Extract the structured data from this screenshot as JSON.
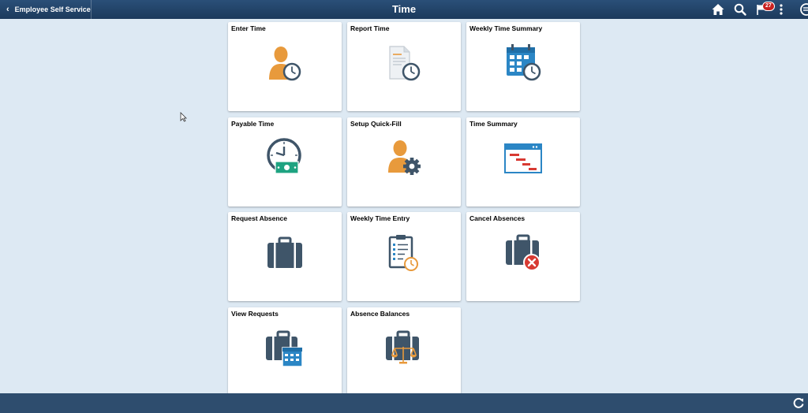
{
  "header": {
    "back_label": "Employee Self Service",
    "title": "Time",
    "notification_count": "27",
    "icons": [
      "home-icon",
      "search-icon",
      "notifications-flag-icon",
      "more-options-icon",
      "navbar-icon"
    ]
  },
  "colors": {
    "header_bg": "#1f4066",
    "page_bg": "#dde9f3",
    "footer_bg": "#2e4d6e",
    "icon_navy": "#3f5569",
    "icon_orange": "#e89a3c",
    "icon_blue": "#2b86c5",
    "icon_green": "#1ea381",
    "icon_red": "#d83a32"
  },
  "tiles": [
    {
      "label": "Enter Time",
      "icon": "person-clock-icon"
    },
    {
      "label": "Report Time",
      "icon": "document-clock-icon"
    },
    {
      "label": "Weekly Time Summary",
      "icon": "calendar-clock-icon"
    },
    {
      "label": "Payable Time",
      "icon": "clock-money-icon"
    },
    {
      "label": "Setup Quick-Fill",
      "icon": "person-gear-icon"
    },
    {
      "label": "Time Summary",
      "icon": "gantt-window-icon"
    },
    {
      "label": "Request Absence",
      "icon": "briefcase-icon"
    },
    {
      "label": "Weekly Time Entry",
      "icon": "clipboard-clock-icon"
    },
    {
      "label": "Cancel Absences",
      "icon": "briefcase-cancel-icon"
    },
    {
      "label": "View Requests",
      "icon": "briefcase-calendar-icon"
    },
    {
      "label": "Absence Balances",
      "icon": "briefcase-scale-icon"
    }
  ],
  "footer": {
    "icon": "refresh-icon"
  }
}
